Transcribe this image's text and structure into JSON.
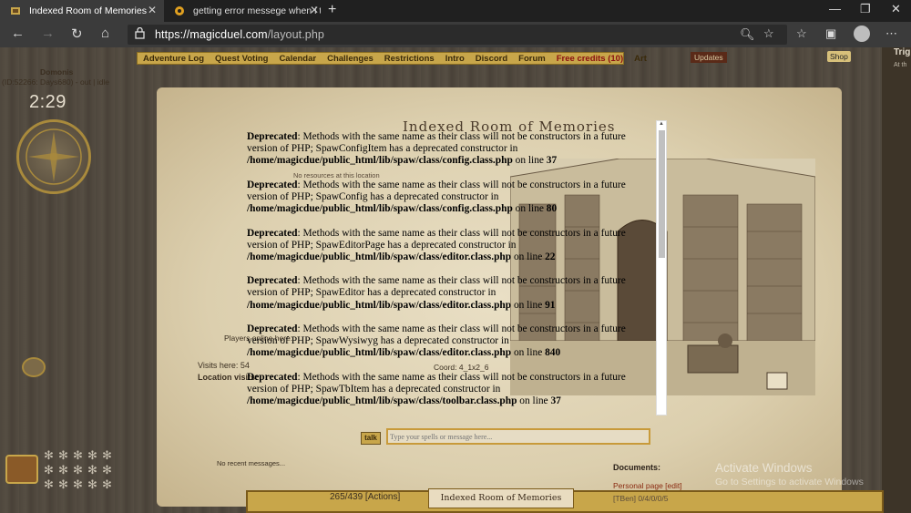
{
  "tabs": [
    {
      "title": "Indexed Room of Memories",
      "close": "✕"
    },
    {
      "title": "getting error messege when i try",
      "close": "✕"
    }
  ],
  "new_tab": "+",
  "window_controls": {
    "minimize": "—",
    "maximize": "❐",
    "close": "✕"
  },
  "address": {
    "host": "https://magicduel.com",
    "path": "/layout.php"
  },
  "nav": [
    "Adventure Log",
    "Quest Voting",
    "Calendar",
    "Challenges",
    "Restrictions",
    "Intro",
    "Discord",
    "Forum",
    "Free credits (10)",
    "Art"
  ],
  "updates": "Updates",
  "shop": "Shop",
  "user": {
    "name": "Domonis",
    "status": "(ID:52266: Days680) - out | idle",
    "clock": "2:29"
  },
  "room": {
    "title": "Indexed Room of Memories",
    "no_resources": "No resources at this location",
    "players_online": "Players online here:",
    "visits": "Visits here: 54",
    "location_visits": "Location visits:",
    "coord": "Coord: 4_1x2_6"
  },
  "errors": [
    {
      "label": "Deprecated",
      "message": ": Methods with the same name as their class will not be constructors in a future version of PHP; SpawConfigItem has a deprecated constructor in ",
      "path": "/home/magicdue/public_html/lib/spaw/class/config.class.php",
      "on_line": " on line ",
      "line": "37"
    },
    {
      "label": "Deprecated",
      "message": ": Methods with the same name as their class will not be constructors in a future version of PHP; SpawConfig has a deprecated constructor in ",
      "path": "/home/magicdue/public_html/lib/spaw/class/config.class.php",
      "on_line": " on line ",
      "line": "80"
    },
    {
      "label": "Deprecated",
      "message": ": Methods with the same name as their class will not be constructors in a future version of PHP; SpawEditorPage has a deprecated constructor in ",
      "path": "/home/magicdue/public_html/lib/spaw/class/editor.class.php",
      "on_line": " on line ",
      "line": "22"
    },
    {
      "label": "Deprecated",
      "message": ": Methods with the same name as their class will not be constructors in a future version of PHP; SpawEditor has a deprecated constructor in ",
      "path": "/home/magicdue/public_html/lib/spaw/class/editor.class.php",
      "on_line": " on line ",
      "line": "91"
    },
    {
      "label": "Deprecated",
      "message": ": Methods with the same name as their class will not be constructors in a future version of PHP; SpawWysiwyg has a deprecated constructor in ",
      "path": "/home/magicdue/public_html/lib/spaw/class/editor.class.php",
      "on_line": " on line ",
      "line": "840"
    },
    {
      "label": "Deprecated",
      "message": ": Methods with the same name as their class will not be constructors in a future version of PHP; SpawTbItem has a deprecated constructor in ",
      "path": "/home/magicdue/public_html/lib/spaw/class/toolbar.class.php",
      "on_line": " on line ",
      "line": "37"
    }
  ],
  "chat": {
    "talk_label": "talk",
    "placeholder": "Type your spells or message here...",
    "no_messages": "No recent messages..."
  },
  "documents": {
    "title": "Documents:",
    "personal_page": "Personal page [edit]",
    "history": "[TBen] 0/4/0/0/5"
  },
  "progress_text": "265/439 [Actions]",
  "bottom_title": "Indexed Room of Memories",
  "right_panel": {
    "title": "Trig",
    "subtitle": "At th"
  },
  "watermark": {
    "line1": "Activate Windows",
    "line2": "Go to Settings to activate Windows"
  },
  "colors": {
    "nav_gold": "#c8a64a",
    "parchment": "#e9dfc5",
    "tab_active": "#3b3b3b"
  }
}
